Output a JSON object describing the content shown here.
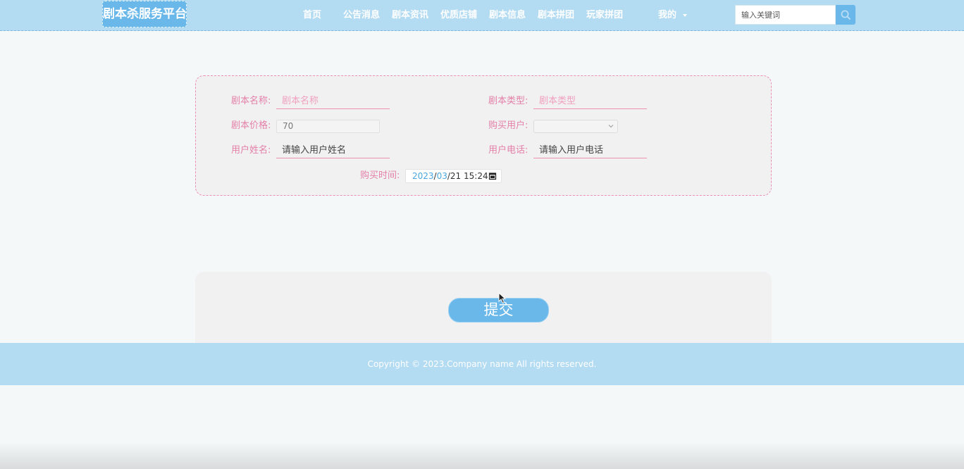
{
  "header": {
    "logo": "剧本杀服务平台",
    "nav": [
      "首页",
      "公告消息",
      "剧本资讯",
      "优质店铺",
      "剧本信息",
      "剧本拼团",
      "玩家拼团",
      "我的"
    ],
    "search_placeholder": "输入关键词",
    "search_icon": "search-icon"
  },
  "form": {
    "script_name_label": "剧本名称:",
    "script_name_placeholder": "剧本名称",
    "script_type_label": "剧本类型:",
    "script_type_placeholder": "剧本类型",
    "price_label": "剧本价格:",
    "price_value": "70",
    "buyer_label": "购买用户:",
    "buyer_value": "",
    "user_name_label": "用户姓名:",
    "user_name_placeholder": "请输入用户姓名",
    "user_phone_label": "用户电话:",
    "user_phone_placeholder": "请输入用户电话",
    "purchase_time_label": "购买时间:",
    "purchase_time": {
      "year": "2023",
      "sep1": "/",
      "month": "03",
      "sep2": "/",
      "day_time": "21 15:24"
    }
  },
  "submit_label": "提交",
  "footer": {
    "copyright": "Copyright © 2023.Company name All rights reserved."
  },
  "colors": {
    "primary": "#6ab8ea",
    "header_bg": "#b3dbf2",
    "label_pink": "#e480a8",
    "card_bg": "#f1f1f2"
  }
}
